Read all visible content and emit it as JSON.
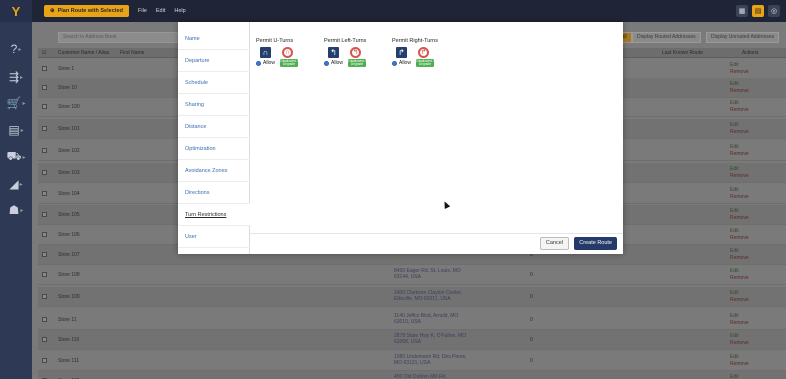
{
  "app": {
    "plan_button": "Plan Route with Selected",
    "menu": [
      "File",
      "Edit",
      "Help"
    ]
  },
  "toolbar": {
    "search_placeholder": "Search in Address Book",
    "select_all": "All",
    "display_routed": "Display Routed Addresses",
    "display_unrouted": "Display Unrouted Addresses"
  },
  "table": {
    "headers": {
      "name": "Customer Name / Alias",
      "first_name": "First Name",
      "last_known_route": "Last Known Route",
      "actions": "Actions"
    },
    "rows": [
      {
        "name": "Store 1",
        "addr": "",
        "zero": ""
      },
      {
        "name": "Store 10",
        "addr": "",
        "zero": ""
      },
      {
        "name": "Store 100",
        "addr": "",
        "zero": ""
      },
      {
        "name": "Store 101",
        "addr": "",
        "zero": ""
      },
      {
        "name": "Store 102",
        "addr": "",
        "zero": ""
      },
      {
        "name": "Store 103",
        "addr": "",
        "zero": ""
      },
      {
        "name": "Store 104",
        "addr": "",
        "zero": ""
      },
      {
        "name": "Store 105",
        "addr": "",
        "zero": ""
      },
      {
        "name": "Store 106",
        "addr": "",
        "zero": ""
      },
      {
        "name": "Store 107",
        "addr": "Charles, MO 63303, USA",
        "zero": "0"
      },
      {
        "name": "Store 108",
        "addr": "8450 Eager Rd, St. Louis, MO 63144, USA",
        "zero": "0"
      },
      {
        "name": "Store 109",
        "addr": "1400 Clarkson Clayton Center, Ellisville, MO 63011, USA",
        "zero": "0"
      },
      {
        "name": "Store 11",
        "addr": "1140 Jeffco Blvd, Arnold, MO 63010, USA",
        "zero": "0"
      },
      {
        "name": "Store 110",
        "addr": "2878 State Hwy K, O'Fallon, MO 63368, USA",
        "zero": "0"
      },
      {
        "name": "Store 111",
        "addr": "1080 Lindemann Rd, Des Peres, MO 63131, USA",
        "zero": "0"
      },
      {
        "name": "Store 112",
        "addr": "450 Old Dobbin Mill Rd,",
        "zero": ""
      }
    ],
    "edit_label": "Edit",
    "remove_label": "Remove"
  },
  "modal": {
    "nav": [
      "Name",
      "Departure",
      "Schedule",
      "Sharing",
      "Distance",
      "Optimization",
      "Avoidance Zones",
      "Directions",
      "Turn Restrictions",
      "User"
    ],
    "permits": [
      {
        "title": "Permit U-Turns",
        "allow": "Allow",
        "badge": "Disallowed / Degrade Unroutable Stop"
      },
      {
        "title": "Permit Left-Turns",
        "allow": "Allow",
        "badge": "Disallowed / Degrade Unroutable Stop"
      },
      {
        "title": "Permit Right-Turns",
        "allow": "Allow",
        "badge": "Disallowed / Degrade Unroutable Stop"
      }
    ],
    "cancel": "Cancel",
    "create_route": "Create Route"
  }
}
